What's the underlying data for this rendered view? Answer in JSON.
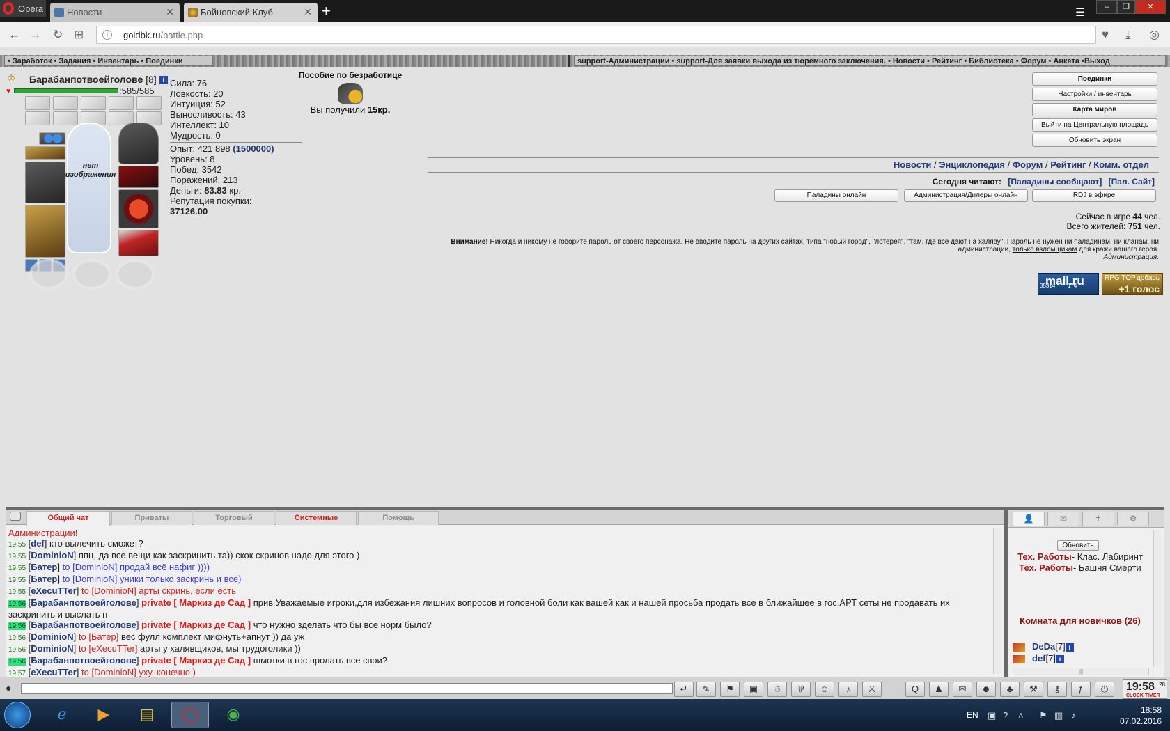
{
  "browser": {
    "opera_label": "Opera",
    "tabs": [
      {
        "label": "Новости",
        "icon": "vk-icon"
      },
      {
        "label": "Бойцовский Клуб",
        "icon": "club-icon"
      }
    ],
    "new_tab": "+",
    "url_host": "goldbk.ru",
    "url_path": "/battle.php"
  },
  "game_menu": {
    "left": "• Заработок • Задания • Инвентарь • Поединки",
    "right": "support-Администрации • support-Для заявки выхода из тюремного заключения. • Новости • Рейтинг • Библиотека • Форум • Анкета •Выход"
  },
  "character": {
    "name": "Барабанпотвоейголове",
    "level": "[8]",
    "hp_text": ":585/585",
    "hp_fraction": 1.0,
    "no_image": "нет изображения"
  },
  "stats": {
    "strength": "Сила: 76",
    "agility": "Ловкость: 20",
    "intuition": "Интуиция: 52",
    "endurance": "Выносливость: 43",
    "intellect": "Интеллект: 10",
    "wisdom": "Мудрость: 0",
    "exp_label": "Опыт: 421 898",
    "exp_next": "(1500000)",
    "level": "Уровень: 8",
    "wins": "Побед: 3542",
    "losses": "Поражений: 213",
    "money_label": "Деньги:",
    "money_value": "83.83",
    "money_unit": "кр.",
    "reputation_label": "Репутация покупки:",
    "reputation_value": "37126.00"
  },
  "benefit": {
    "title": "Пособие по безработице",
    "received_label": "Вы получили",
    "received_value": "15кр."
  },
  "right_buttons": [
    {
      "label": "Поединки",
      "bold": true
    },
    {
      "label": "Настройки / инвентарь",
      "bold": false
    },
    {
      "label": "Карта миров",
      "bold": true
    },
    {
      "label": "Выйти на Центральную площадь",
      "bold": false
    },
    {
      "label": "Обновить экран",
      "bold": false
    }
  ],
  "links": {
    "news": "Новости",
    "encyclopedia": "Энциклопедия",
    "forum": "Форум",
    "rating": "Рейтинг",
    "comm": "Комм. отдел",
    "sep": "/"
  },
  "today": {
    "label": "Сегодня читают:",
    "paladins": "[Паладины сообщают]",
    "site": "[Пал. Сайт]"
  },
  "wide_buttons": [
    "Паладины онлайн",
    "Администрация/Дилеры онлайн",
    "RDJ в эфире"
  ],
  "online": {
    "now_label": "Сейчас в игре",
    "now_count": "44",
    "now_unit": "чел.",
    "total_label": "Всего жителей:",
    "total_count": "751",
    "total_unit": "чел."
  },
  "warning": {
    "title": "Внимание!",
    "text1": " Никогда и никому не говорите пароль от своего персонажа. Не вводите пароль на других сайтах, типа \"новый город\", \"лотерея\", \"там, где все дают на халяву\". Пароль не нужен ни паладинам, ни кланам, ни администрации, ",
    "link": "только взломщикам",
    "text2": " для кражи вашего героя.",
    "sign": "Администрация."
  },
  "counters": {
    "mailru": "mail.ru",
    "mailru_a": "35314",
    "mailru_b": "174",
    "rpg_top": "RPG TOP",
    "rpg_add": "добавь",
    "rpg_vote": "+1 голос"
  },
  "chat": {
    "tabs": [
      {
        "label": "Общий чат",
        "style": "active"
      },
      {
        "label": "Приваты",
        "style": ""
      },
      {
        "label": "Торговый",
        "style": ""
      },
      {
        "label": "Системные",
        "style": "red"
      },
      {
        "label": "Помощь",
        "style": ""
      }
    ],
    "first_line": "Администрации!",
    "messages": [
      {
        "ts": "19:55",
        "hl": false,
        "nick": "def",
        "to": "",
        "text": " кто вылечить сможет?",
        "color": ""
      },
      {
        "ts": "19:55",
        "hl": false,
        "nick": "DominioN",
        "to": "",
        "text": " ппц, да все вещи как заскринить та)) скок скринов надо для этого )",
        "color": ""
      },
      {
        "ts": "19:55",
        "hl": false,
        "nick": "Батер",
        "to": " to [DominioN]",
        "text": " продай всё нафиг ))))",
        "color": "blue"
      },
      {
        "ts": "19:55",
        "hl": false,
        "nick": "Батер",
        "to": " to [DominioN]",
        "text": " уники только заскринь и всё)",
        "color": "blue"
      },
      {
        "ts": "19:55",
        "hl": false,
        "nick": "eXecuTTer",
        "to": " to [DominioN]",
        "text": " арты скринь, если есть",
        "color": "red"
      },
      {
        "ts": "19:56",
        "hl": true,
        "nick": "Барабанпотвоейголове",
        "priv": " private [ Маркиз де Сад ]",
        "text": " прив Уважаемые игроки,для избежания лишних вопросов и головной боли как вашей как и нашей просьба продать все в ближайшее в гос,АРТ сеты не продавать их заскринить и выслать н",
        "color": ""
      },
      {
        "ts": "19:56",
        "hl": true,
        "nick": "Барабанпотвоейголове",
        "priv": " private [ Маркиз де Сад ]",
        "text": " что нужно зделать что бы все норм было?",
        "color": ""
      },
      {
        "ts": "19:56",
        "hl": false,
        "nick": "DominioN",
        "to": " to [Батер]",
        "text": " вес фулл комплект мифнуть+апнут )) да уж",
        "color": ""
      },
      {
        "ts": "19:56",
        "hl": false,
        "nick": "DominioN",
        "to": " to [eXecuTTer]",
        "text": " арты у халявщиков, мы трудоголики ))",
        "color": ""
      },
      {
        "ts": "19:56",
        "hl": true,
        "nick": "Барабанпотвоейголове",
        "priv": " private [ Маркиз де Сад ]",
        "text": " шмотки в гос пролать все свои?",
        "color": ""
      },
      {
        "ts": "19:57",
        "hl": false,
        "nick": "eXecuTTer",
        "to": " to [DominioN]",
        "text": " уху, конечно )",
        "color": "red"
      }
    ]
  },
  "side": {
    "refresh": "Обновить",
    "tech1_title": "Тех. Работы",
    "tech1_text": "- Клас. Лабиринт",
    "tech2_title": "Тех. Работы",
    "tech2_text": "- Башня Смерти",
    "room": "Комната для новичков (26)",
    "users": [
      {
        "name": "DeDa",
        "lvl": "[7]"
      },
      {
        "name": "def",
        "lvl": "[7]"
      }
    ]
  },
  "clock": {
    "time": "19:58",
    "tag1": "CLOCK",
    "tag2": "TIMER",
    "secs": "28"
  },
  "taskbar": {
    "lang": "EN",
    "time": "18:58",
    "date": "07.02.2016"
  }
}
